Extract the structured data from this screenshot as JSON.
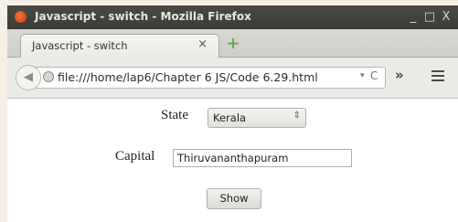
{
  "window": {
    "title": "Javascript - switch - Mozilla Firefox",
    "controls": {
      "minimize": "_",
      "maximize": "□",
      "close": "X"
    }
  },
  "tabs": [
    {
      "label": "Javascript - switch",
      "close": "×"
    }
  ],
  "new_tab": {
    "label": "+"
  },
  "toolbar": {
    "back": "◀",
    "url": "file:///home/lap6/Chapter 6 JS/Code 6.29.html",
    "url_dropdown": "▾",
    "reload": "C",
    "overflow": "»"
  },
  "form": {
    "state": {
      "label": "State",
      "value": "Kerala",
      "arrow": "⇕"
    },
    "capital": {
      "label": "Capital",
      "value": "Thiruvananthapuram"
    },
    "show_button": "Show"
  }
}
